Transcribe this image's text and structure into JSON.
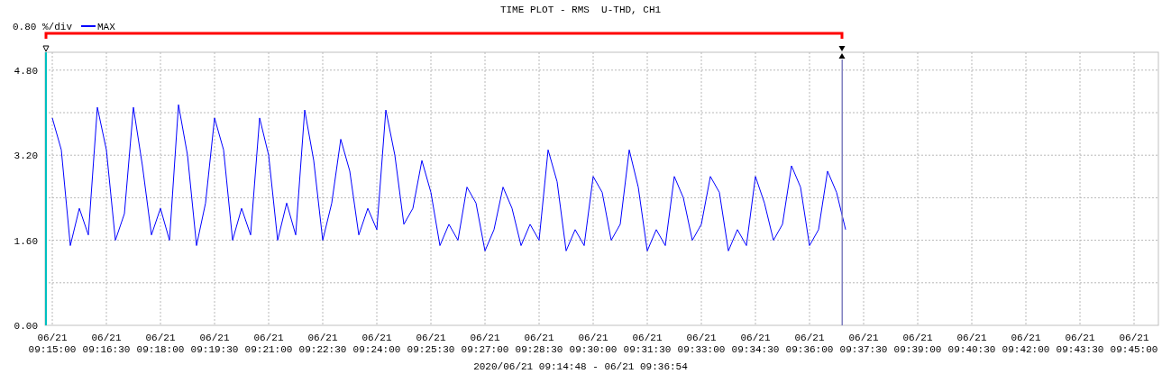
{
  "chart_data": {
    "type": "line",
    "title": "TIME PLOT - RMS  U-THD, CH1",
    "ylabel": "0.80 %/div",
    "xlabel": "2020/06/21 09:14:48 - 06/21 09:36:54",
    "categories": [
      "06/21 09:15:00",
      null,
      null,
      null,
      null,
      null,
      "06/21 09:16:30",
      null,
      null,
      null,
      null,
      null,
      "06/21 09:18:00",
      null,
      null,
      null,
      null,
      null,
      "06/21 09:19:30",
      null,
      null,
      null,
      null,
      null,
      "06/21 09:21:00",
      null,
      null,
      null,
      null,
      null,
      "06/21 09:22:30",
      null,
      null,
      null,
      null,
      null,
      "06/21 09:24:00",
      null,
      null,
      null,
      null,
      null,
      "06/21 09:25:30",
      null,
      null,
      null,
      null,
      null,
      "06/21 09:27:00",
      null,
      null,
      null,
      null,
      null,
      "06/21 09:28:30",
      null,
      null,
      null,
      null,
      null,
      "06/21 09:30:00",
      null,
      null,
      null,
      null,
      null,
      "06/21 09:31:30",
      null,
      null,
      null,
      null,
      null,
      "06/21 09:33:00",
      null,
      null,
      null,
      null,
      null,
      "06/21 09:34:30",
      null,
      null,
      null,
      null,
      null,
      "06/21 09:36:00",
      null,
      null,
      null,
      null,
      null,
      "06/21 09:37:30",
      null,
      null,
      null,
      null,
      null,
      "06/21 09:39:00",
      null,
      null,
      null,
      null,
      null,
      "06/21 09:40:30",
      null,
      null,
      null,
      null,
      null,
      "06/21 09:42:00",
      null,
      null,
      null,
      null,
      null,
      "06/21 09:43:30",
      null,
      null,
      null,
      null,
      null,
      "06/21 09:45:00"
    ],
    "series": [
      {
        "name": "MAX",
        "color": "#0000ff",
        "values": [
          3.9,
          3.3,
          1.5,
          2.2,
          1.7,
          4.1,
          3.3,
          1.6,
          2.1,
          4.1,
          3.0,
          1.7,
          2.2,
          1.6,
          4.15,
          3.2,
          1.5,
          2.3,
          3.9,
          3.3,
          1.6,
          2.2,
          1.7,
          3.9,
          3.2,
          1.6,
          2.3,
          1.7,
          4.05,
          3.1,
          1.6,
          2.3,
          3.5,
          2.9,
          1.7,
          2.2,
          1.8,
          4.05,
          3.2,
          1.9,
          2.2,
          3.1,
          2.5,
          1.5,
          1.9,
          1.6,
          2.6,
          2.3,
          1.4,
          1.8,
          2.6,
          2.2,
          1.5,
          1.9,
          1.6,
          3.3,
          2.7,
          1.4,
          1.8,
          1.5,
          2.8,
          2.5,
          1.6,
          1.9,
          3.3,
          2.6,
          1.4,
          1.8,
          1.5,
          2.8,
          2.4,
          1.6,
          1.9,
          2.8,
          2.5,
          1.4,
          1.8,
          1.5,
          2.8,
          2.3,
          1.6,
          1.9,
          3.0,
          2.6,
          1.5,
          1.8,
          2.9,
          2.5,
          1.8,
          null,
          null,
          null,
          null,
          null,
          null,
          null,
          null,
          null,
          null,
          null,
          null,
          null,
          null,
          null,
          null,
          null,
          null,
          null,
          null,
          null,
          null,
          null,
          null,
          null,
          null,
          null,
          null,
          null,
          null,
          null,
          null
        ]
      }
    ],
    "ylim": [
      0,
      5.136
    ],
    "grid": true,
    "yticks": [
      {
        "value": 0,
        "label": "0.00"
      },
      {
        "value": 1.6,
        "label": "1.60"
      },
      {
        "value": 3.2,
        "label": "3.20"
      },
      {
        "value": 4.8,
        "label": "4.80"
      }
    ]
  },
  "cursors": [
    {
      "kind": "start",
      "color": "#00c0c0"
    },
    {
      "kind": "end",
      "color": "#8080c0"
    }
  ]
}
